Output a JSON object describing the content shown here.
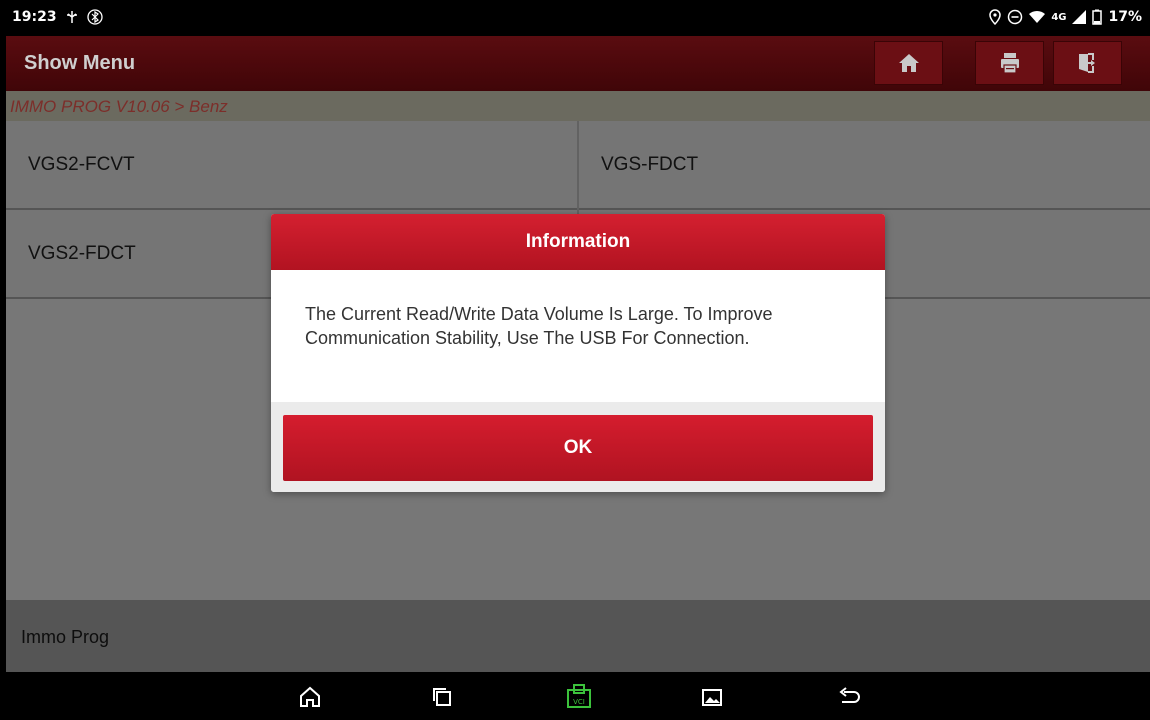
{
  "status_bar": {
    "time": "19:23",
    "battery": "17%",
    "network": "4G",
    "icons": [
      "usb-debug-icon",
      "bluetooth-icon",
      "location-icon",
      "dnd-icon",
      "wifi-icon",
      "signal-icon",
      "battery-icon"
    ]
  },
  "header": {
    "title": "Show Menu",
    "buttons": [
      "home-icon",
      "print-icon",
      "exit-icon"
    ]
  },
  "breadcrumb": "IMMO PROG V10.06 > Benz",
  "menu": {
    "items": [
      "VGS2-FCVT",
      "VGS-FDCT",
      "VGS2-FDCT",
      ""
    ]
  },
  "footer": {
    "label": "Immo Prog"
  },
  "dialog": {
    "title": "Information",
    "message_line1": "The Current Read/Write Data Volume Is Large. To Improve",
    "message_line2": "Communication Stability, Use The USB For Connection.",
    "ok_label": "OK"
  },
  "nav_bar": {
    "buttons": [
      "home-icon",
      "recents-icon",
      "vci-icon",
      "gallery-icon",
      "back-icon"
    ],
    "vci_label": "VCI"
  },
  "colors": {
    "title_bar": "#400508",
    "breadcrumb_text": "#7c2e2a",
    "dialog_accent": "#c8182a",
    "vci_green": "#3cc23c"
  }
}
